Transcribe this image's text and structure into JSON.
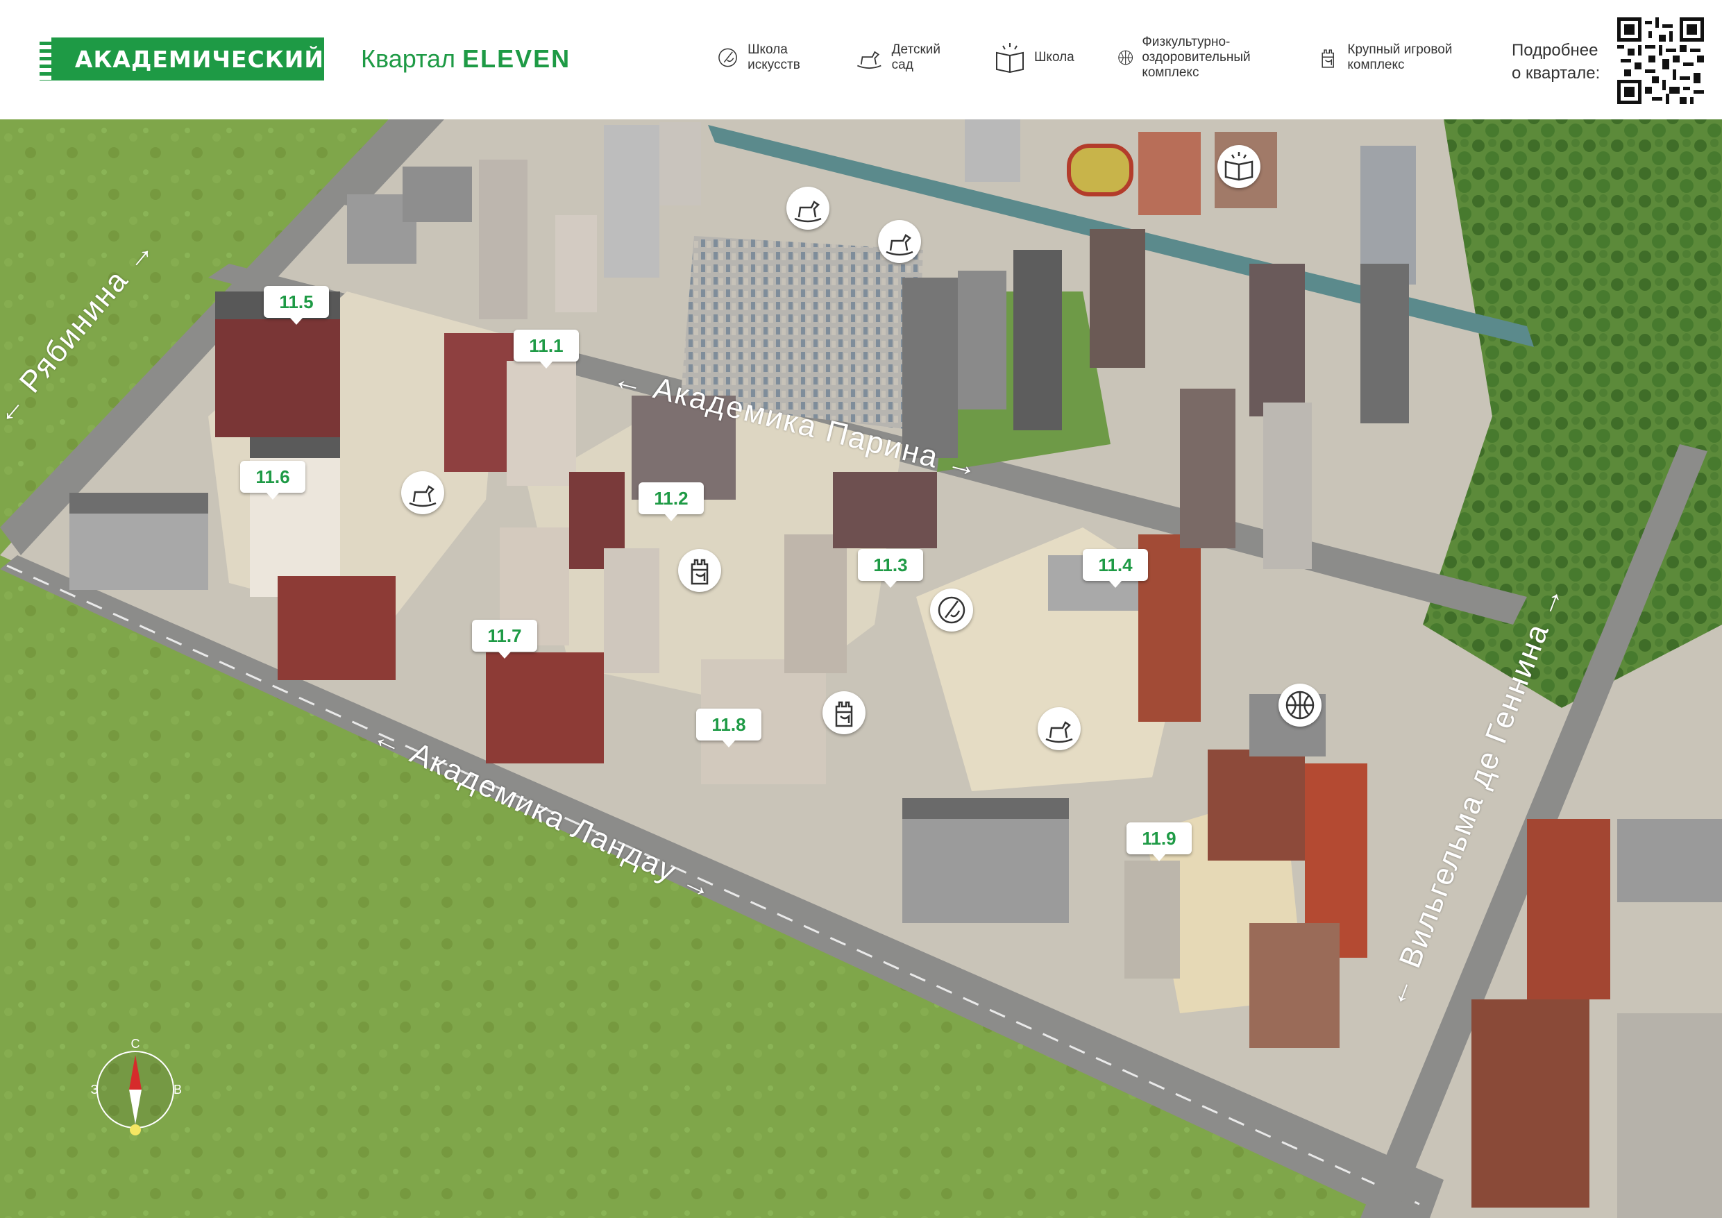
{
  "header": {
    "logo_text": "АКАДЕМИЧЕСКИЙ",
    "quarter_prefix": "Квартал",
    "quarter_name": "ELEVEN",
    "legend": [
      {
        "icon": "art-school-icon",
        "label": "Школа искусств"
      },
      {
        "icon": "kindergarten-icon",
        "label": "Детский сад"
      },
      {
        "icon": "school-icon",
        "label": "Школа"
      },
      {
        "icon": "sports-complex-icon",
        "label": "Физкультурно-оздоровительный комплекс"
      },
      {
        "icon": "playground-icon",
        "label": "Крупный игровой комплекс"
      }
    ],
    "more_line1": "Подробнее",
    "more_line2": "о квартале:"
  },
  "streets": {
    "ryabinina": "← Рябинина →",
    "parina": "← Академика Парина →",
    "landau": "← Академика Ландау →",
    "gennina": "← Вильгельма де Геннина →"
  },
  "buildings": [
    "11.1",
    "11.2",
    "11.3",
    "11.4",
    "11.5",
    "11.6",
    "11.7",
    "11.8",
    "11.9"
  ],
  "compass": {
    "north": "С",
    "west": "З",
    "east": "В"
  },
  "colors": {
    "brand_green": "#1e9a45",
    "field_green": "#7fa64a",
    "road_gray": "#8c8c8a",
    "plaza": "#d9d4c8"
  }
}
